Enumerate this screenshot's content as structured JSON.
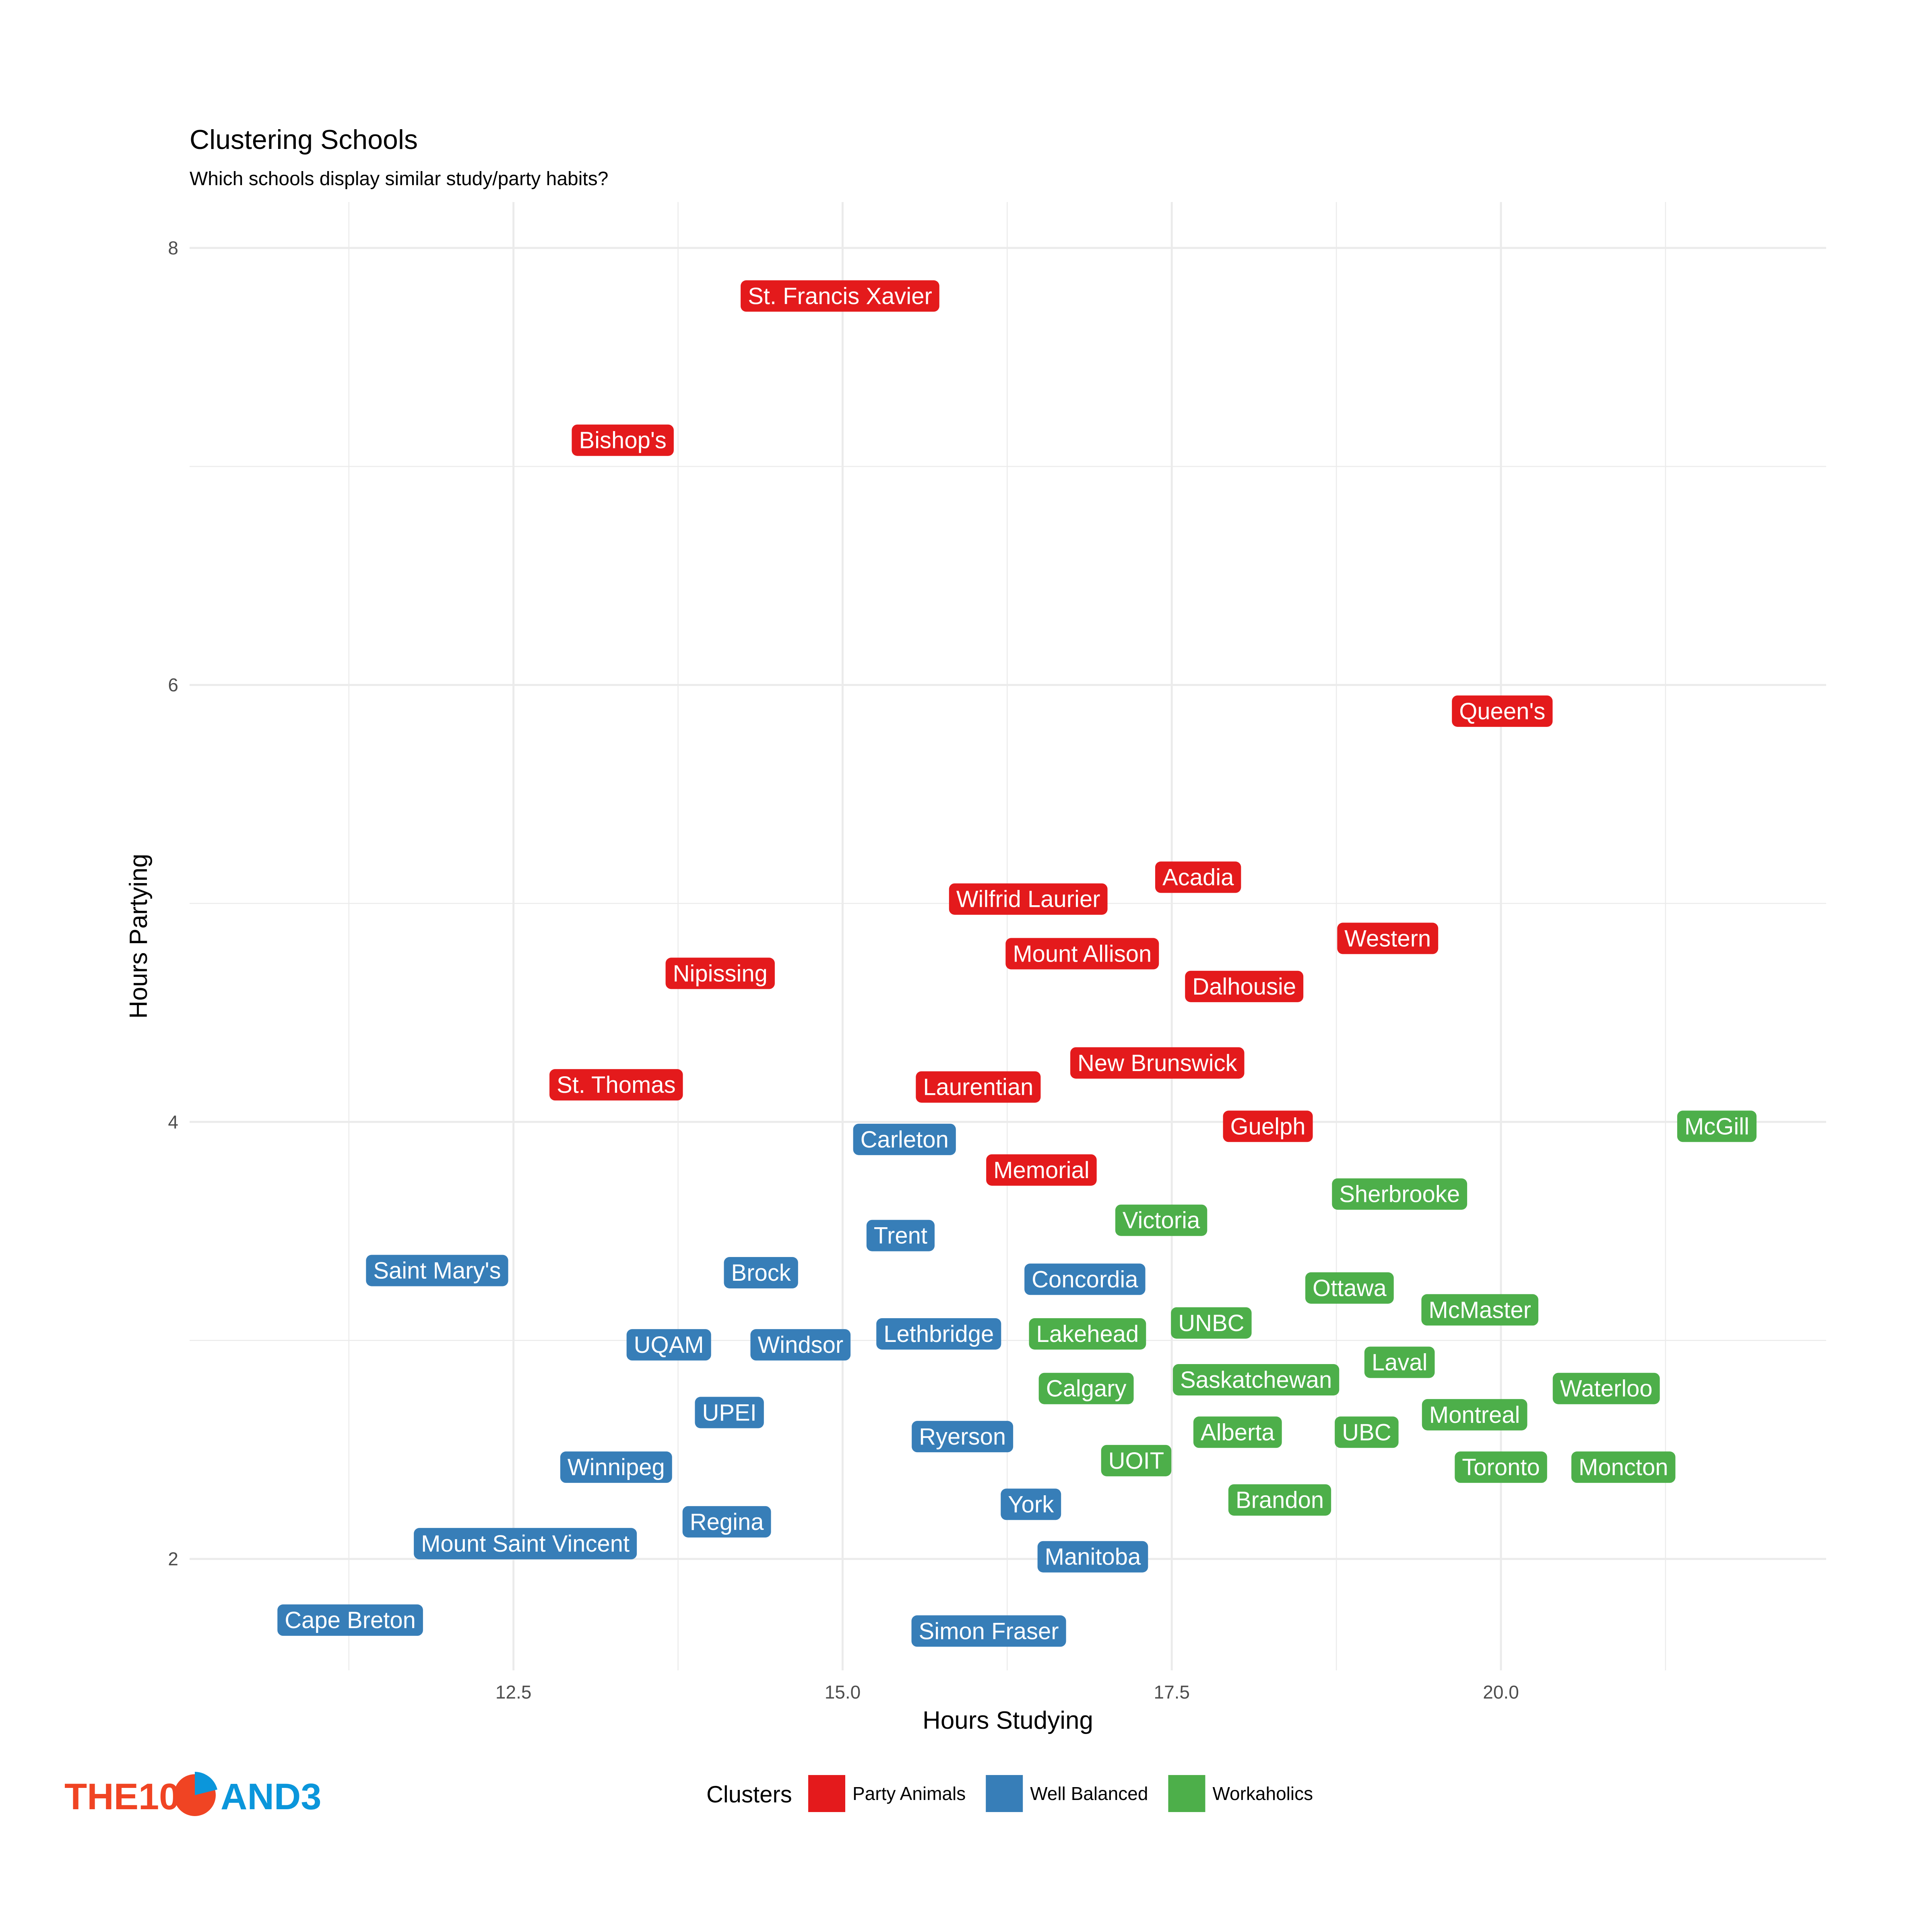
{
  "chart_data": {
    "type": "scatter",
    "title": "Clustering Schools",
    "subtitle": "Which schools display similar study/party habits?",
    "xlabel": "Hours Studying",
    "ylabel": "Hours Partying",
    "xlim": [
      10.04,
      22.47
    ],
    "ylim": [
      1.49,
      8.21
    ],
    "x_ticks": [
      12.5,
      15.0,
      17.5,
      20.0
    ],
    "x_tick_labels": [
      "12.5",
      "15.0",
      "17.5",
      "20.0"
    ],
    "y_ticks": [
      2,
      4,
      6,
      8
    ],
    "y_tick_labels": [
      "2",
      "4",
      "6",
      "8"
    ],
    "x_minor": [
      11.25,
      13.75,
      16.25,
      18.75,
      21.25
    ],
    "y_minor": [
      3,
      5,
      7
    ],
    "grid": true,
    "legend": {
      "title": "Clusters",
      "position": "bottom",
      "entries": [
        {
          "name": "Party Animals",
          "color": "#E41A1C"
        },
        {
          "name": "Well Balanced",
          "color": "#377EB8"
        },
        {
          "name": "Workaholics",
          "color": "#4DAF4A"
        }
      ]
    },
    "points": [
      {
        "label": "St. Francis Xavier",
        "x": 14.98,
        "y": 7.78,
        "cluster": "Party Animals"
      },
      {
        "label": "Bishop's",
        "x": 13.33,
        "y": 7.12,
        "cluster": "Party Animals"
      },
      {
        "label": "Queen's",
        "x": 20.01,
        "y": 5.88,
        "cluster": "Party Animals"
      },
      {
        "label": "Acadia",
        "x": 17.7,
        "y": 5.12,
        "cluster": "Party Animals"
      },
      {
        "label": "Wilfrid Laurier",
        "x": 16.41,
        "y": 5.02,
        "cluster": "Party Animals"
      },
      {
        "label": "Western",
        "x": 19.14,
        "y": 4.84,
        "cluster": "Party Animals"
      },
      {
        "label": "Mount Allison",
        "x": 16.82,
        "y": 4.77,
        "cluster": "Party Animals"
      },
      {
        "label": "Nipissing",
        "x": 14.07,
        "y": 4.68,
        "cluster": "Party Animals"
      },
      {
        "label": "Dalhousie",
        "x": 18.05,
        "y": 4.62,
        "cluster": "Party Animals"
      },
      {
        "label": "New Brunswick",
        "x": 17.39,
        "y": 4.27,
        "cluster": "Party Animals"
      },
      {
        "label": "St. Thomas",
        "x": 13.28,
        "y": 4.17,
        "cluster": "Party Animals"
      },
      {
        "label": "Laurentian",
        "x": 16.03,
        "y": 4.16,
        "cluster": "Party Animals"
      },
      {
        "label": "Guelph",
        "x": 18.23,
        "y": 3.98,
        "cluster": "Party Animals"
      },
      {
        "label": "Memorial",
        "x": 16.51,
        "y": 3.78,
        "cluster": "Party Animals"
      },
      {
        "label": "McGill",
        "x": 21.64,
        "y": 3.98,
        "cluster": "Workaholics"
      },
      {
        "label": "Carleton",
        "x": 15.47,
        "y": 3.92,
        "cluster": "Well Balanced"
      },
      {
        "label": "Sherbrooke",
        "x": 19.23,
        "y": 3.67,
        "cluster": "Workaholics"
      },
      {
        "label": "Victoria",
        "x": 17.42,
        "y": 3.55,
        "cluster": "Workaholics"
      },
      {
        "label": "Trent",
        "x": 15.44,
        "y": 3.48,
        "cluster": "Well Balanced"
      },
      {
        "label": "Saint Mary's",
        "x": 11.92,
        "y": 3.32,
        "cluster": "Well Balanced"
      },
      {
        "label": "Brock",
        "x": 14.38,
        "y": 3.31,
        "cluster": "Well Balanced"
      },
      {
        "label": "Concordia",
        "x": 16.84,
        "y": 3.28,
        "cluster": "Well Balanced"
      },
      {
        "label": "Ottawa",
        "x": 18.85,
        "y": 3.24,
        "cluster": "Workaholics"
      },
      {
        "label": "McMaster",
        "x": 19.84,
        "y": 3.14,
        "cluster": "Workaholics"
      },
      {
        "label": "UNBC",
        "x": 17.8,
        "y": 3.08,
        "cluster": "Workaholics"
      },
      {
        "label": "Lethbridge",
        "x": 15.73,
        "y": 3.03,
        "cluster": "Well Balanced"
      },
      {
        "label": "Lakehead",
        "x": 16.86,
        "y": 3.03,
        "cluster": "Workaholics"
      },
      {
        "label": "UQAM",
        "x": 13.68,
        "y": 2.98,
        "cluster": "Well Balanced"
      },
      {
        "label": "Windsor",
        "x": 14.68,
        "y": 2.98,
        "cluster": "Well Balanced"
      },
      {
        "label": "Laval",
        "x": 19.23,
        "y": 2.9,
        "cluster": "Workaholics"
      },
      {
        "label": "Saskatchewan",
        "x": 18.14,
        "y": 2.82,
        "cluster": "Workaholics"
      },
      {
        "label": "Calgary",
        "x": 16.85,
        "y": 2.78,
        "cluster": "Workaholics"
      },
      {
        "label": "Waterloo",
        "x": 20.8,
        "y": 2.78,
        "cluster": "Workaholics"
      },
      {
        "label": "UPEI",
        "x": 14.14,
        "y": 2.67,
        "cluster": "Well Balanced"
      },
      {
        "label": "Montreal",
        "x": 19.8,
        "y": 2.66,
        "cluster": "Workaholics"
      },
      {
        "label": "Alberta",
        "x": 18.0,
        "y": 2.58,
        "cluster": "Workaholics"
      },
      {
        "label": "UBC",
        "x": 18.98,
        "y": 2.58,
        "cluster": "Workaholics"
      },
      {
        "label": "Ryerson",
        "x": 15.91,
        "y": 2.56,
        "cluster": "Well Balanced"
      },
      {
        "label": "UOIT",
        "x": 17.23,
        "y": 2.45,
        "cluster": "Workaholics"
      },
      {
        "label": "Winnipeg",
        "x": 13.28,
        "y": 2.42,
        "cluster": "Well Balanced"
      },
      {
        "label": "Toronto",
        "x": 20.0,
        "y": 2.42,
        "cluster": "Workaholics"
      },
      {
        "label": "Moncton",
        "x": 20.93,
        "y": 2.42,
        "cluster": "Workaholics"
      },
      {
        "label": "Brandon",
        "x": 18.32,
        "y": 2.27,
        "cluster": "Workaholics"
      },
      {
        "label": "York",
        "x": 16.43,
        "y": 2.25,
        "cluster": "Well Balanced"
      },
      {
        "label": "Regina",
        "x": 14.12,
        "y": 2.17,
        "cluster": "Well Balanced"
      },
      {
        "label": "Mount Saint Vincent",
        "x": 12.59,
        "y": 2.07,
        "cluster": "Well Balanced"
      },
      {
        "label": "Manitoba",
        "x": 16.9,
        "y": 2.01,
        "cluster": "Well Balanced"
      },
      {
        "label": "Cape Breton",
        "x": 11.26,
        "y": 1.72,
        "cluster": "Well Balanced"
      },
      {
        "label": "Simon Fraser",
        "x": 16.11,
        "y": 1.67,
        "cluster": "Well Balanced"
      }
    ]
  },
  "logo": {
    "left_text": "THE10",
    "right_text": "AND3",
    "left_color": "#F04423",
    "right_color": "#0B96DB"
  }
}
